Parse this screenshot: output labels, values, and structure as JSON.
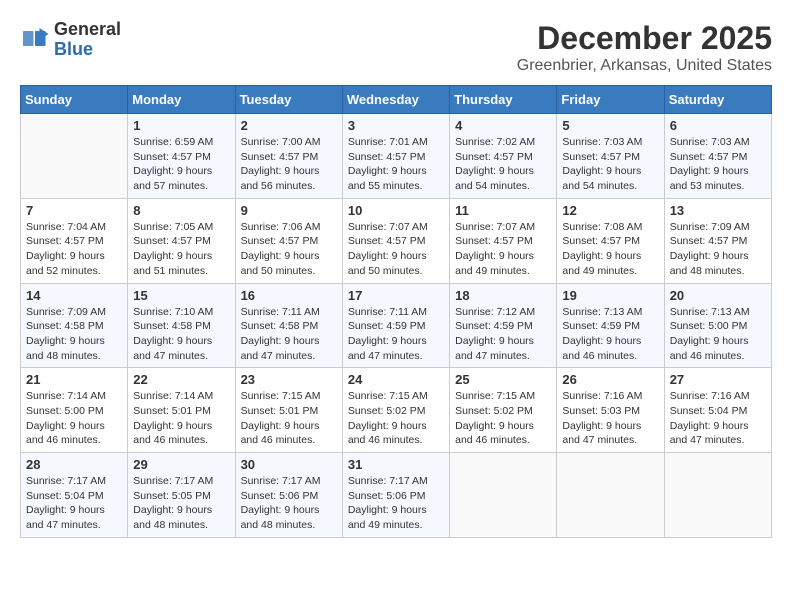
{
  "header": {
    "logo_line1": "General",
    "logo_line2": "Blue",
    "title": "December 2025",
    "subtitle": "Greenbrier, Arkansas, United States"
  },
  "weekdays": [
    "Sunday",
    "Monday",
    "Tuesday",
    "Wednesday",
    "Thursday",
    "Friday",
    "Saturday"
  ],
  "weeks": [
    [
      {
        "day": "",
        "info": ""
      },
      {
        "day": "1",
        "info": "Sunrise: 6:59 AM\nSunset: 4:57 PM\nDaylight: 9 hours\nand 57 minutes."
      },
      {
        "day": "2",
        "info": "Sunrise: 7:00 AM\nSunset: 4:57 PM\nDaylight: 9 hours\nand 56 minutes."
      },
      {
        "day": "3",
        "info": "Sunrise: 7:01 AM\nSunset: 4:57 PM\nDaylight: 9 hours\nand 55 minutes."
      },
      {
        "day": "4",
        "info": "Sunrise: 7:02 AM\nSunset: 4:57 PM\nDaylight: 9 hours\nand 54 minutes."
      },
      {
        "day": "5",
        "info": "Sunrise: 7:03 AM\nSunset: 4:57 PM\nDaylight: 9 hours\nand 54 minutes."
      },
      {
        "day": "6",
        "info": "Sunrise: 7:03 AM\nSunset: 4:57 PM\nDaylight: 9 hours\nand 53 minutes."
      }
    ],
    [
      {
        "day": "7",
        "info": "Sunrise: 7:04 AM\nSunset: 4:57 PM\nDaylight: 9 hours\nand 52 minutes."
      },
      {
        "day": "8",
        "info": "Sunrise: 7:05 AM\nSunset: 4:57 PM\nDaylight: 9 hours\nand 51 minutes."
      },
      {
        "day": "9",
        "info": "Sunrise: 7:06 AM\nSunset: 4:57 PM\nDaylight: 9 hours\nand 50 minutes."
      },
      {
        "day": "10",
        "info": "Sunrise: 7:07 AM\nSunset: 4:57 PM\nDaylight: 9 hours\nand 50 minutes."
      },
      {
        "day": "11",
        "info": "Sunrise: 7:07 AM\nSunset: 4:57 PM\nDaylight: 9 hours\nand 49 minutes."
      },
      {
        "day": "12",
        "info": "Sunrise: 7:08 AM\nSunset: 4:57 PM\nDaylight: 9 hours\nand 49 minutes."
      },
      {
        "day": "13",
        "info": "Sunrise: 7:09 AM\nSunset: 4:57 PM\nDaylight: 9 hours\nand 48 minutes."
      }
    ],
    [
      {
        "day": "14",
        "info": "Sunrise: 7:09 AM\nSunset: 4:58 PM\nDaylight: 9 hours\nand 48 minutes."
      },
      {
        "day": "15",
        "info": "Sunrise: 7:10 AM\nSunset: 4:58 PM\nDaylight: 9 hours\nand 47 minutes."
      },
      {
        "day": "16",
        "info": "Sunrise: 7:11 AM\nSunset: 4:58 PM\nDaylight: 9 hours\nand 47 minutes."
      },
      {
        "day": "17",
        "info": "Sunrise: 7:11 AM\nSunset: 4:59 PM\nDaylight: 9 hours\nand 47 minutes."
      },
      {
        "day": "18",
        "info": "Sunrise: 7:12 AM\nSunset: 4:59 PM\nDaylight: 9 hours\nand 47 minutes."
      },
      {
        "day": "19",
        "info": "Sunrise: 7:13 AM\nSunset: 4:59 PM\nDaylight: 9 hours\nand 46 minutes."
      },
      {
        "day": "20",
        "info": "Sunrise: 7:13 AM\nSunset: 5:00 PM\nDaylight: 9 hours\nand 46 minutes."
      }
    ],
    [
      {
        "day": "21",
        "info": "Sunrise: 7:14 AM\nSunset: 5:00 PM\nDaylight: 9 hours\nand 46 minutes."
      },
      {
        "day": "22",
        "info": "Sunrise: 7:14 AM\nSunset: 5:01 PM\nDaylight: 9 hours\nand 46 minutes."
      },
      {
        "day": "23",
        "info": "Sunrise: 7:15 AM\nSunset: 5:01 PM\nDaylight: 9 hours\nand 46 minutes."
      },
      {
        "day": "24",
        "info": "Sunrise: 7:15 AM\nSunset: 5:02 PM\nDaylight: 9 hours\nand 46 minutes."
      },
      {
        "day": "25",
        "info": "Sunrise: 7:15 AM\nSunset: 5:02 PM\nDaylight: 9 hours\nand 46 minutes."
      },
      {
        "day": "26",
        "info": "Sunrise: 7:16 AM\nSunset: 5:03 PM\nDaylight: 9 hours\nand 47 minutes."
      },
      {
        "day": "27",
        "info": "Sunrise: 7:16 AM\nSunset: 5:04 PM\nDaylight: 9 hours\nand 47 minutes."
      }
    ],
    [
      {
        "day": "28",
        "info": "Sunrise: 7:17 AM\nSunset: 5:04 PM\nDaylight: 9 hours\nand 47 minutes."
      },
      {
        "day": "29",
        "info": "Sunrise: 7:17 AM\nSunset: 5:05 PM\nDaylight: 9 hours\nand 48 minutes."
      },
      {
        "day": "30",
        "info": "Sunrise: 7:17 AM\nSunset: 5:06 PM\nDaylight: 9 hours\nand 48 minutes."
      },
      {
        "day": "31",
        "info": "Sunrise: 7:17 AM\nSunset: 5:06 PM\nDaylight: 9 hours\nand 49 minutes."
      },
      {
        "day": "",
        "info": ""
      },
      {
        "day": "",
        "info": ""
      },
      {
        "day": "",
        "info": ""
      }
    ]
  ]
}
